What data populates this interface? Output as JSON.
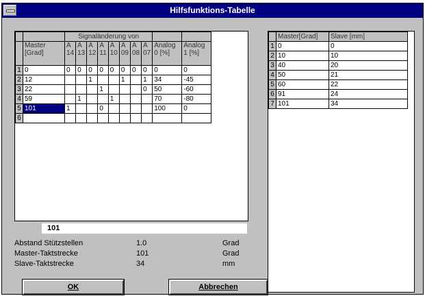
{
  "window": {
    "title": "Hilfsfunktions-Tabelle"
  },
  "left_table": {
    "group_header": "Signaländerung von",
    "columns": [
      "Master [Grad]",
      "A 14",
      "A 13",
      "A 12",
      "A 11",
      "A 10",
      "A 09",
      "A 08",
      "A 07",
      "Analog 0 [%]",
      "Analog 1 [%]"
    ],
    "rows": [
      {
        "n": "1",
        "cells": [
          "0",
          "0",
          "0",
          "0",
          "0",
          "0",
          "0",
          "0",
          "0",
          "0",
          "0"
        ]
      },
      {
        "n": "2",
        "cells": [
          "12",
          "",
          "",
          "1",
          "",
          "",
          "1",
          "",
          "1",
          "34",
          "-45"
        ]
      },
      {
        "n": "3",
        "cells": [
          "22",
          "",
          "",
          "",
          "1",
          "",
          "",
          "",
          "0",
          "50",
          "-60"
        ]
      },
      {
        "n": "4",
        "cells": [
          "59",
          "",
          "1",
          "",
          "",
          "1",
          "",
          "",
          "",
          "70",
          "-80"
        ]
      },
      {
        "n": "5",
        "cells": [
          "101",
          "1",
          "",
          "",
          "0",
          "",
          "",
          "",
          "",
          "100",
          "0"
        ]
      },
      {
        "n": "6",
        "cells": [
          "",
          "",
          "",
          "",
          "",
          "",
          "",
          "",
          "",
          "",
          ""
        ]
      }
    ]
  },
  "edit_value": "101",
  "info": {
    "rows": [
      {
        "label": "Abstand Stützstellen",
        "value": "1.0",
        "unit": "Grad"
      },
      {
        "label": "Master-Taktstrecke",
        "value": "101",
        "unit": "Grad"
      },
      {
        "label": "Slave-Taktstrecke",
        "value": "34",
        "unit": "mm"
      }
    ]
  },
  "right_table": {
    "columns": [
      "Master[Grad]",
      "Slave [mm]"
    ],
    "rows": [
      {
        "n": "1",
        "cells": [
          "0",
          "0"
        ]
      },
      {
        "n": "2",
        "cells": [
          "10",
          "10"
        ]
      },
      {
        "n": "3",
        "cells": [
          "40",
          "20"
        ]
      },
      {
        "n": "4",
        "cells": [
          "50",
          "21"
        ]
      },
      {
        "n": "5",
        "cells": [
          "60",
          "22"
        ]
      },
      {
        "n": "6",
        "cells": [
          "91",
          "24"
        ]
      },
      {
        "n": "7",
        "cells": [
          "101",
          "34"
        ]
      }
    ]
  },
  "buttons": {
    "ok": "OK",
    "cancel": "Abbrechen"
  }
}
